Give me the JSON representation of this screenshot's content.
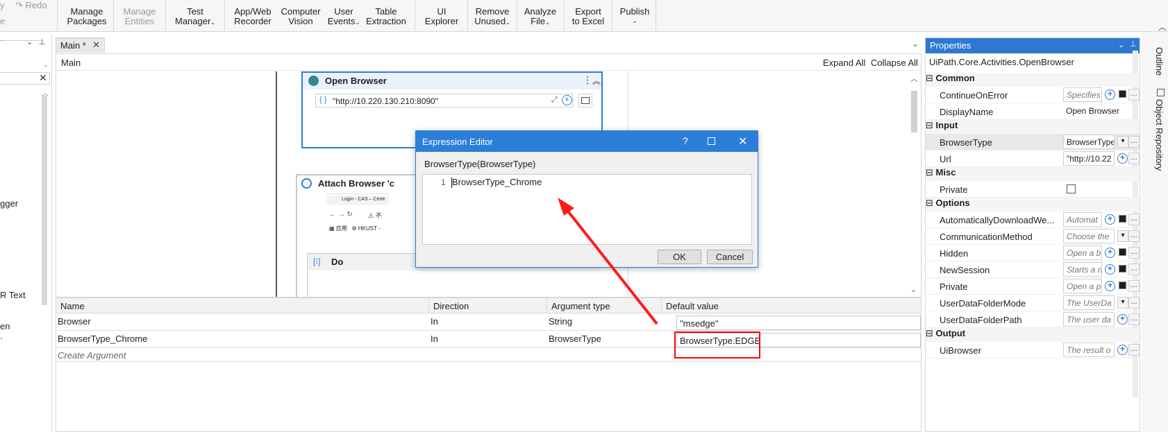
{
  "ribbon": {
    "undo_fragment": "y",
    "undo_sub": "e",
    "redo": "Redo",
    "buttons": [
      {
        "line1": "Manage",
        "line2": "Packages",
        "disabled": false
      },
      {
        "line1": "Manage",
        "line2": "Entities",
        "disabled": true
      },
      {
        "line1": "Test",
        "line2": "Manager",
        "disabled": false
      },
      {
        "line1": "App/Web",
        "line2": "Recorder",
        "disabled": false
      },
      {
        "line1": "Computer",
        "line2": "Vision",
        "disabled": false
      },
      {
        "line1": "User",
        "line2": "Events",
        "disabled": false
      },
      {
        "line1": "Table",
        "line2": "Extraction",
        "disabled": false
      },
      {
        "line1": "UI",
        "line2": "Explorer",
        "disabled": false
      },
      {
        "line1": "Remove",
        "line2": "Unused",
        "disabled": false
      },
      {
        "line1": "Analyze",
        "line2": "File",
        "disabled": false
      },
      {
        "line1": "Export",
        "line2": "to Excel",
        "disabled": false
      },
      {
        "line1": "Publish",
        "line2": "",
        "disabled": false
      }
    ]
  },
  "left_panel": {
    "texts": [
      "gger",
      "R Text",
      "en"
    ]
  },
  "document_tab": {
    "label": "Main *"
  },
  "designer": {
    "breadcrumb": "Main",
    "expand_all": "Expand All",
    "collapse_all": "Collapse All",
    "open_browser": {
      "title": "Open Browser",
      "url": "\"http://10.220.130.210:8090\""
    },
    "attach_browser": {
      "title": "Attach Browser 'c",
      "tab_text": "Login - CAS – Centr",
      "nav_text": "不",
      "bookmark1": "应用",
      "bookmark2": "HKUST -"
    },
    "do": {
      "title": "Do"
    }
  },
  "arguments": {
    "headers": [
      "Name",
      "Direction",
      "Argument type",
      "Default value"
    ],
    "rows": [
      {
        "name": "Browser",
        "direction": "In",
        "type": "String",
        "default": "\"msedge\""
      },
      {
        "name": "BrowserType_Chrome",
        "direction": "In",
        "type": "BrowserType",
        "default": "BrowserType.EDGE"
      }
    ],
    "create": "Create Argument"
  },
  "properties": {
    "title": "Properties",
    "activity": "UiPath.Core.Activities.OpenBrowser",
    "categories": [
      {
        "name": "Common",
        "rows": [
          {
            "name": "ContinueOnError",
            "value": "Specifies",
            "hint": true
          },
          {
            "name": "DisplayName",
            "value": "Open Browser",
            "hint": false
          }
        ]
      },
      {
        "name": "Input",
        "rows": [
          {
            "name": "BrowserType",
            "value": "BrowserType",
            "hint": false
          },
          {
            "name": "Url",
            "value": "\"http://10.22",
            "hint": false
          }
        ]
      },
      {
        "name": "Misc",
        "rows": [
          {
            "name": "Private",
            "value": "",
            "hint": false
          }
        ]
      },
      {
        "name": "Options",
        "rows": [
          {
            "name": "AutomaticallyDownloadWe...",
            "value": "Automat",
            "hint": true
          },
          {
            "name": "CommunicationMethod",
            "value": "Choose the",
            "hint": true
          },
          {
            "name": "Hidden",
            "value": "Open a b",
            "hint": true
          },
          {
            "name": "NewSession",
            "value": "Starts a n",
            "hint": true
          },
          {
            "name": "Private",
            "value": "Open a p",
            "hint": true
          },
          {
            "name": "UserDataFolderMode",
            "value": "The UserDa",
            "hint": true
          },
          {
            "name": "UserDataFolderPath",
            "value": "The user da",
            "hint": true
          }
        ]
      },
      {
        "name": "Output",
        "rows": [
          {
            "name": "UiBrowser",
            "value": "The result o",
            "hint": true
          }
        ]
      }
    ]
  },
  "side_tabs": {
    "outline": "Outline",
    "object_repository": "Object Repository"
  },
  "dialog": {
    "title": "Expression Editor",
    "help": "?",
    "label": "BrowserType(BrowserType)",
    "line_number": "1",
    "code": "BrowserType_Chrome",
    "ok": "OK",
    "cancel": "Cancel"
  },
  "annotation_color": "#ff0000"
}
